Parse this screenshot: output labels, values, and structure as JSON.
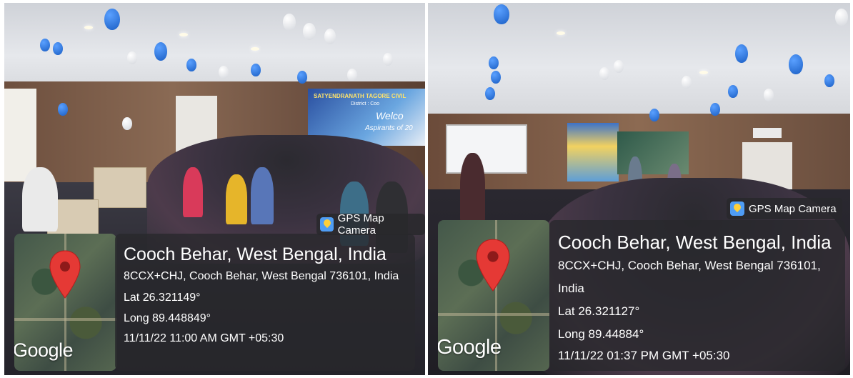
{
  "left_photo": {
    "banner_text": "SATYENDRANATH TAGORE CIVIL",
    "banner_sub": "District : Coo",
    "banner_welcome": "Welco",
    "banner_aspirants": "Aspirants of 20",
    "badge_label": "GPS Map Camera",
    "location_title": "Cooch Behar, West Bengal, India",
    "address": "8CCX+CHJ, Cooch Behar, West Bengal 736101, India",
    "lat": "Lat 26.321149°",
    "long": "Long 89.448849°",
    "datetime": "11/11/22 11:00 AM GMT +05:30",
    "map_brand": "Google"
  },
  "right_photo": {
    "badge_label": "GPS Map Camera",
    "location_title": "Cooch Behar, West Bengal, India",
    "address_line1": "8CCX+CHJ, Cooch Behar, West Bengal 736101,",
    "address_line2": "India",
    "lat": "Lat 26.321127°",
    "long": "Long 89.44884°",
    "datetime": "11/11/22 01:37 PM GMT +05:30",
    "map_brand": "Google"
  },
  "colors": {
    "pin_red": "#e53935",
    "card_bg": "rgba(40,40,44,0.78)",
    "balloon_blue": "#1a5ec4"
  }
}
